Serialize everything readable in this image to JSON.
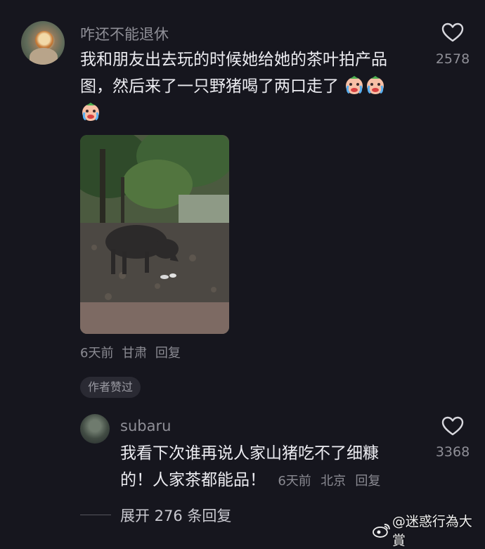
{
  "comments": [
    {
      "username": "咋还不能退休",
      "text_line1": "我和朋友出去玩的时候她给她的茶叶拍产品",
      "text_line2": "图，然后来了一只野猪喝了两口走了",
      "emoji": "crying-face-emoji",
      "likes": "2578",
      "time": "6天前",
      "location": "甘肃",
      "reply_label": "回复",
      "author_badge": "作者赞过"
    },
    {
      "username": "subaru",
      "text_line1": "我看下次谁再说人家山猪吃不了细糠",
      "text_line2": "的！人家茶都能品！",
      "likes": "3368",
      "time": "6天前",
      "location": "北京",
      "reply_label": "回复"
    }
  ],
  "expand_replies": "展开 276 条回复",
  "watermark": "@迷惑行為大賞",
  "icons": {
    "like": "heart-outline-icon",
    "weibo": "weibo-logo-icon"
  },
  "colors": {
    "background": "#16161e",
    "text": "#ececf1",
    "muted": "#8f8f97"
  }
}
